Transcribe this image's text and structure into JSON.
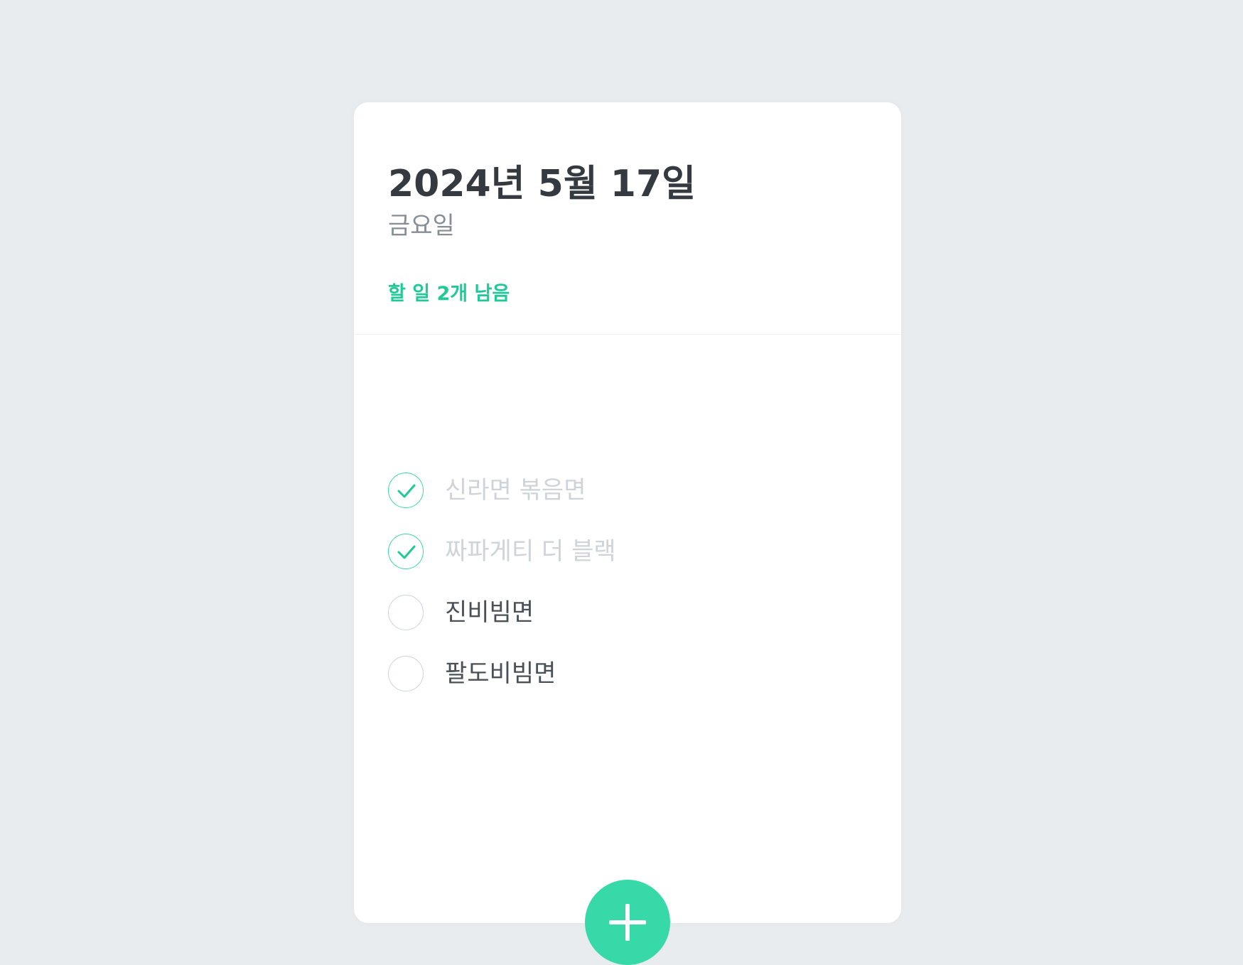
{
  "header": {
    "date": "2024년 5월 17일",
    "weekday": "금요일",
    "remaining": "할 일 2개 남음"
  },
  "todos": [
    {
      "text": "신라면 볶음면",
      "done": true
    },
    {
      "text": "짜파게티 더 블랙",
      "done": true
    },
    {
      "text": "진비빔면",
      "done": false
    },
    {
      "text": "팔도비빔면",
      "done": false
    }
  ],
  "colors": {
    "accent": "#38d9a9",
    "accent_text": "#20c997",
    "background": "#e9ecef",
    "done_text": "#ced4da",
    "title": "#343a40"
  },
  "icons": {
    "check": "check-icon",
    "add": "plus-icon"
  }
}
